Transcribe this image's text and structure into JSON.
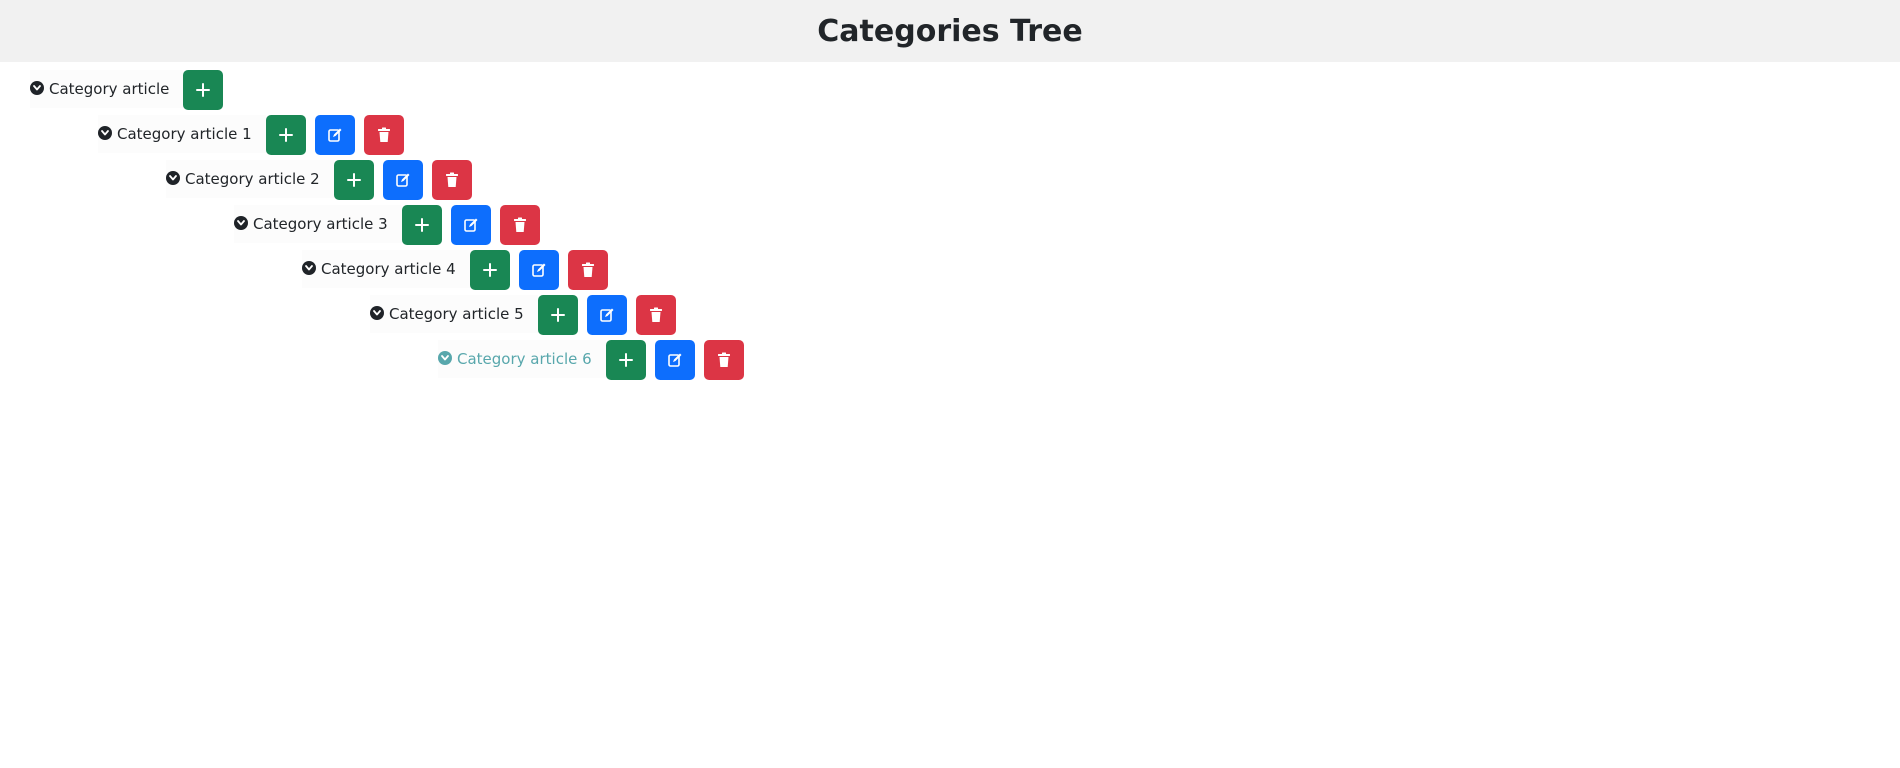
{
  "header": {
    "title": "Categories Tree"
  },
  "tree": {
    "items": [
      {
        "label": "Category article",
        "level": 0,
        "actions": [
          "add"
        ]
      },
      {
        "label": "Category article 1",
        "level": 1,
        "actions": [
          "add",
          "edit",
          "delete"
        ]
      },
      {
        "label": "Category article 2",
        "level": 2,
        "actions": [
          "add",
          "edit",
          "delete"
        ]
      },
      {
        "label": "Category article 3",
        "level": 3,
        "actions": [
          "add",
          "edit",
          "delete"
        ]
      },
      {
        "label": "Category article 4",
        "level": 4,
        "actions": [
          "add",
          "edit",
          "delete"
        ]
      },
      {
        "label": "Category article 5",
        "level": 5,
        "actions": [
          "add",
          "edit",
          "delete"
        ]
      },
      {
        "label": "Category article 6",
        "level": 6,
        "actions": [
          "add",
          "edit",
          "delete"
        ],
        "active": true
      }
    ]
  },
  "icons": {
    "toggle": "chevron-down-icon",
    "add": "plus-icon",
    "edit": "edit-icon",
    "delete": "trash-icon"
  },
  "colors": {
    "header_bg": "#f1f1f1",
    "add": "#198754",
    "edit": "#0d6efd",
    "delete": "#dc3545",
    "active_text": "#58a7ac"
  }
}
